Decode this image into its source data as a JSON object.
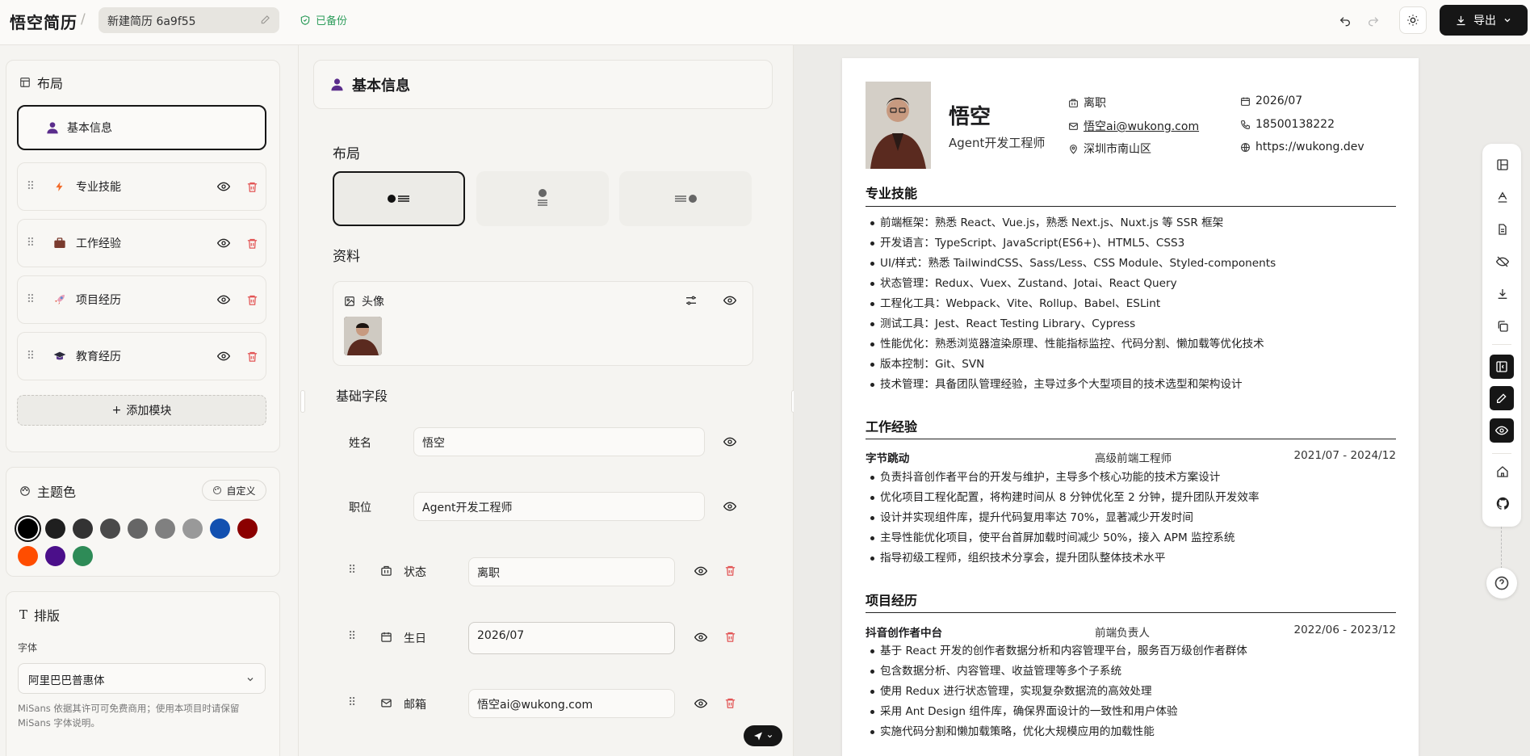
{
  "header": {
    "brand": "悟空简历",
    "separator": "/",
    "title_value": "新建简历 6a9f55",
    "backup_status": "已备份",
    "export_label": "导出"
  },
  "left": {
    "layout_title": "布局",
    "modules": [
      {
        "label": "基本信息",
        "icon": "user-icon"
      },
      {
        "label": "专业技能",
        "icon": "lightning-icon"
      },
      {
        "label": "工作经验",
        "icon": "briefcase-icon"
      },
      {
        "label": "项目经历",
        "icon": "rocket-icon"
      },
      {
        "label": "教育经历",
        "icon": "graduation-cap-icon"
      }
    ],
    "add_module": "添加模块",
    "theme_title": "主题色",
    "custom_label": "自定义",
    "colors": [
      "#000000",
      "#1f1f1f",
      "#333333",
      "#4a4a4a",
      "#666666",
      "#808080",
      "#999999",
      "#1250b0",
      "#8b0000",
      "#ff4d00",
      "#4b0f8a",
      "#2e8b57"
    ],
    "selected_color": "#000000",
    "typo_title": "排版",
    "font_label": "字体",
    "font_value": "阿里巴巴普惠体",
    "font_note": "MiSans 依据其许可可免费商用；使用本项目时请保留 MiSans 字体说明。"
  },
  "middle": {
    "panel_title": "基本信息",
    "layout_label": "布局",
    "profile_label": "资料",
    "avatar_label": "头像",
    "basic_fields_label": "基础字段",
    "fields": [
      {
        "label": "姓名",
        "value": "悟空"
      },
      {
        "label": "职位",
        "value": "Agent开发工程师"
      }
    ],
    "extra_fields": [
      {
        "label": "状态",
        "value": "离职",
        "icon": "building-icon"
      },
      {
        "label": "生日",
        "value": "2026/07",
        "icon": "calendar-icon"
      },
      {
        "label": "邮箱",
        "value": "悟空ai@wukong.com",
        "icon": "mail-icon"
      }
    ]
  },
  "resume": {
    "name": "悟空",
    "role": "Agent开发工程师",
    "status": "离职",
    "birthday": "2026/07",
    "email": "悟空ai@wukong.com",
    "phone": "18500138222",
    "location": "深圳市南山区",
    "website": "https://wukong.dev",
    "skills_title": "专业技能",
    "skills": [
      "前端框架：熟悉 React、Vue.js，熟悉 Next.js、Nuxt.js 等 SSR 框架",
      "开发语言：TypeScript、JavaScript(ES6+)、HTML5、CSS3",
      "UI/样式：熟悉 TailwindCSS、Sass/Less、CSS Module、Styled-components",
      "状态管理：Redux、Vuex、Zustand、Jotai、React Query",
      "工程化工具：Webpack、Vite、Rollup、Babel、ESLint",
      "测试工具：Jest、React Testing Library、Cypress",
      "性能优化：熟悉浏览器渲染原理、性能指标监控、代码分割、懒加载等优化技术",
      "版本控制：Git、SVN",
      "技术管理：具备团队管理经验，主导过多个大型项目的技术选型和架构设计"
    ],
    "work_title": "工作经验",
    "work": {
      "company": "字节跳动",
      "position": "高级前端工程师",
      "period": "2021/07 - 2024/12",
      "items": [
        "负责抖音创作者平台的开发与维护，主导多个核心功能的技术方案设计",
        "优化项目工程化配置，将构建时间从 8 分钟优化至 2 分钟，提升团队开发效率",
        "设计并实现组件库，提升代码复用率达 70%，显著减少开发时间",
        "主导性能优化项目，使平台首屏加载时间减少 50%，接入 APM 监控系统",
        "指导初级工程师，组织技术分享会，提升团队整体技术水平"
      ]
    },
    "project_title": "项目经历",
    "project": {
      "name": "抖音创作者中台",
      "role": "前端负责人",
      "period": "2022/06 - 2023/12",
      "items": [
        "基于 React 开发的创作者数据分析和内容管理平台，服务百万级创作者群体",
        "包含数据分析、内容管理、收益管理等多个子系统",
        "使用 Redux 进行状态管理，实现复杂数据流的高效处理",
        "采用 Ant Design 组件库，确保界面设计的一致性和用户体验",
        "实施代码分割和懒加载策略，优化大规模应用的加载性能"
      ]
    }
  }
}
